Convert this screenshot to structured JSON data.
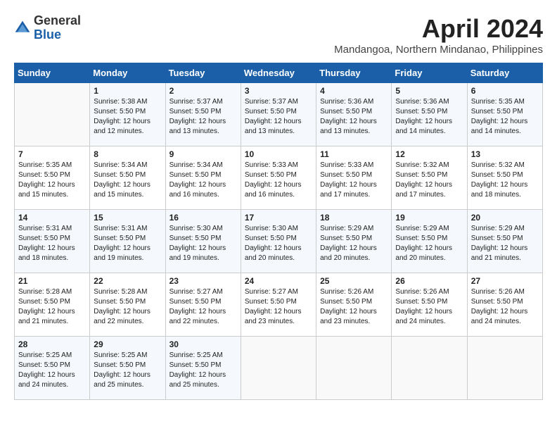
{
  "header": {
    "logo_general": "General",
    "logo_blue": "Blue",
    "title": "April 2024",
    "location": "Mandangoa, Northern Mindanao, Philippines"
  },
  "weekdays": [
    "Sunday",
    "Monday",
    "Tuesday",
    "Wednesday",
    "Thursday",
    "Friday",
    "Saturday"
  ],
  "weeks": [
    [
      {
        "day": "",
        "info": ""
      },
      {
        "day": "1",
        "info": "Sunrise: 5:38 AM\nSunset: 5:50 PM\nDaylight: 12 hours\nand 12 minutes."
      },
      {
        "day": "2",
        "info": "Sunrise: 5:37 AM\nSunset: 5:50 PM\nDaylight: 12 hours\nand 13 minutes."
      },
      {
        "day": "3",
        "info": "Sunrise: 5:37 AM\nSunset: 5:50 PM\nDaylight: 12 hours\nand 13 minutes."
      },
      {
        "day": "4",
        "info": "Sunrise: 5:36 AM\nSunset: 5:50 PM\nDaylight: 12 hours\nand 13 minutes."
      },
      {
        "day": "5",
        "info": "Sunrise: 5:36 AM\nSunset: 5:50 PM\nDaylight: 12 hours\nand 14 minutes."
      },
      {
        "day": "6",
        "info": "Sunrise: 5:35 AM\nSunset: 5:50 PM\nDaylight: 12 hours\nand 14 minutes."
      }
    ],
    [
      {
        "day": "7",
        "info": "Sunrise: 5:35 AM\nSunset: 5:50 PM\nDaylight: 12 hours\nand 15 minutes."
      },
      {
        "day": "8",
        "info": "Sunrise: 5:34 AM\nSunset: 5:50 PM\nDaylight: 12 hours\nand 15 minutes."
      },
      {
        "day": "9",
        "info": "Sunrise: 5:34 AM\nSunset: 5:50 PM\nDaylight: 12 hours\nand 16 minutes."
      },
      {
        "day": "10",
        "info": "Sunrise: 5:33 AM\nSunset: 5:50 PM\nDaylight: 12 hours\nand 16 minutes."
      },
      {
        "day": "11",
        "info": "Sunrise: 5:33 AM\nSunset: 5:50 PM\nDaylight: 12 hours\nand 17 minutes."
      },
      {
        "day": "12",
        "info": "Sunrise: 5:32 AM\nSunset: 5:50 PM\nDaylight: 12 hours\nand 17 minutes."
      },
      {
        "day": "13",
        "info": "Sunrise: 5:32 AM\nSunset: 5:50 PM\nDaylight: 12 hours\nand 18 minutes."
      }
    ],
    [
      {
        "day": "14",
        "info": "Sunrise: 5:31 AM\nSunset: 5:50 PM\nDaylight: 12 hours\nand 18 minutes."
      },
      {
        "day": "15",
        "info": "Sunrise: 5:31 AM\nSunset: 5:50 PM\nDaylight: 12 hours\nand 19 minutes."
      },
      {
        "day": "16",
        "info": "Sunrise: 5:30 AM\nSunset: 5:50 PM\nDaylight: 12 hours\nand 19 minutes."
      },
      {
        "day": "17",
        "info": "Sunrise: 5:30 AM\nSunset: 5:50 PM\nDaylight: 12 hours\nand 20 minutes."
      },
      {
        "day": "18",
        "info": "Sunrise: 5:29 AM\nSunset: 5:50 PM\nDaylight: 12 hours\nand 20 minutes."
      },
      {
        "day": "19",
        "info": "Sunrise: 5:29 AM\nSunset: 5:50 PM\nDaylight: 12 hours\nand 20 minutes."
      },
      {
        "day": "20",
        "info": "Sunrise: 5:29 AM\nSunset: 5:50 PM\nDaylight: 12 hours\nand 21 minutes."
      }
    ],
    [
      {
        "day": "21",
        "info": "Sunrise: 5:28 AM\nSunset: 5:50 PM\nDaylight: 12 hours\nand 21 minutes."
      },
      {
        "day": "22",
        "info": "Sunrise: 5:28 AM\nSunset: 5:50 PM\nDaylight: 12 hours\nand 22 minutes."
      },
      {
        "day": "23",
        "info": "Sunrise: 5:27 AM\nSunset: 5:50 PM\nDaylight: 12 hours\nand 22 minutes."
      },
      {
        "day": "24",
        "info": "Sunrise: 5:27 AM\nSunset: 5:50 PM\nDaylight: 12 hours\nand 23 minutes."
      },
      {
        "day": "25",
        "info": "Sunrise: 5:26 AM\nSunset: 5:50 PM\nDaylight: 12 hours\nand 23 minutes."
      },
      {
        "day": "26",
        "info": "Sunrise: 5:26 AM\nSunset: 5:50 PM\nDaylight: 12 hours\nand 24 minutes."
      },
      {
        "day": "27",
        "info": "Sunrise: 5:26 AM\nSunset: 5:50 PM\nDaylight: 12 hours\nand 24 minutes."
      }
    ],
    [
      {
        "day": "28",
        "info": "Sunrise: 5:25 AM\nSunset: 5:50 PM\nDaylight: 12 hours\nand 24 minutes."
      },
      {
        "day": "29",
        "info": "Sunrise: 5:25 AM\nSunset: 5:50 PM\nDaylight: 12 hours\nand 25 minutes."
      },
      {
        "day": "30",
        "info": "Sunrise: 5:25 AM\nSunset: 5:50 PM\nDaylight: 12 hours\nand 25 minutes."
      },
      {
        "day": "",
        "info": ""
      },
      {
        "day": "",
        "info": ""
      },
      {
        "day": "",
        "info": ""
      },
      {
        "day": "",
        "info": ""
      }
    ]
  ]
}
